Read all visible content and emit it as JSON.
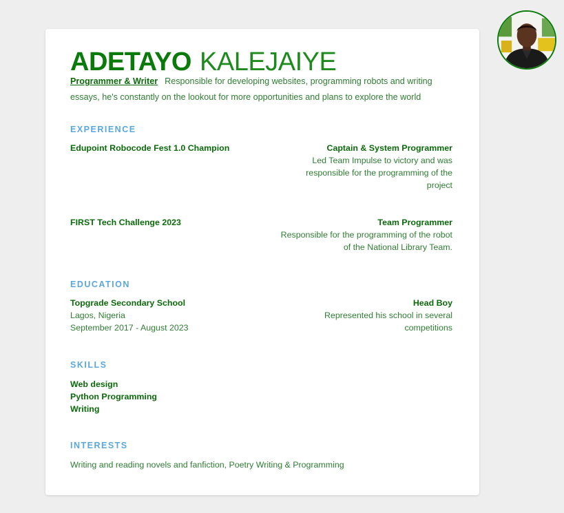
{
  "header": {
    "first_name": "ADETAYO",
    "last_name": "KALEJAIYE",
    "role": "Programmer & Writer",
    "summary": "Responsible for developing websites, programming robots and writing essays, he's constantly on the lookout for more opportunities and plans to explore the world"
  },
  "experience": {
    "title": "EXPERIENCE",
    "items": [
      {
        "name": "Edupoint Robocode Fest 1.0 Champion",
        "role": "Captain & System Programmer",
        "description": "Led Team Impulse to victory and was responsible for the programming of the project"
      },
      {
        "name": "FIRST Tech Challenge 2023",
        "role": "Team Programmer",
        "description": "Responsible for the programming of the robot of the National Library Team."
      }
    ]
  },
  "education": {
    "title": "EDUCATION",
    "items": [
      {
        "school": "Topgrade Secondary School",
        "location": "Lagos, Nigeria",
        "dates": "September 2017 - August 2023",
        "role": "Head Boy",
        "description": "Represented his school in several competitions"
      }
    ]
  },
  "skills": {
    "title": "SKILLS",
    "items": [
      "Web design",
      "Python Programming",
      "Writing"
    ]
  },
  "interests": {
    "title": "INTERESTS",
    "text": "Writing and reading novels and fanfiction, Poetry Writing & Programming"
  },
  "colors": {
    "accent_green": "#0a7a0a",
    "section_blue": "#5aa7de",
    "background": "#eeeeee"
  }
}
